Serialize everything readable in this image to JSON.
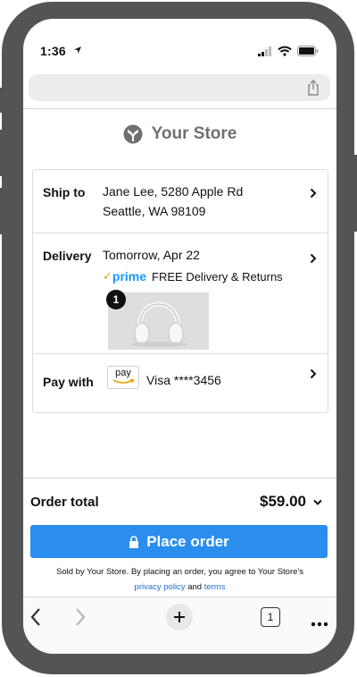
{
  "status_bar": {
    "time": "1:36"
  },
  "store": {
    "name": "Your Store"
  },
  "ship_to": {
    "label": "Ship to",
    "line1": "Jane Lee, 5280 Apple Rd",
    "line2": "Seattle, WA 98109"
  },
  "delivery": {
    "label": "Delivery",
    "date": "Tomorrow, Apr 22",
    "prime_logo": "prime",
    "prime_text": "FREE Delivery & Returns",
    "badge": "1"
  },
  "payment": {
    "label": "Pay with",
    "provider": "pay",
    "card": "Visa ****3456"
  },
  "order": {
    "total_label": "Order total",
    "total_value": "$59.00",
    "place_button": "Place order"
  },
  "legal": {
    "text": "Sold by Your Store. By placing an order, you agree to Your Store's",
    "privacy_link": "privacy policy",
    "and": "and",
    "terms_link": "terms"
  },
  "toolbar": {
    "tabs_count": "1"
  },
  "colors": {
    "accent": "#2b8dee",
    "frame": "#545454",
    "prime_blue": "#1a98ff",
    "prime_check": "#f0a000"
  },
  "icons": [
    "location-arrow-icon",
    "signal-icon",
    "wifi-icon",
    "battery-icon",
    "share-icon",
    "store-logo-icon",
    "chevron-right-icon",
    "prime-check-icon",
    "pay-logo-icon",
    "lock-icon",
    "back-icon",
    "forward-icon",
    "new-tab-icon",
    "tabs-icon",
    "more-icon"
  ]
}
